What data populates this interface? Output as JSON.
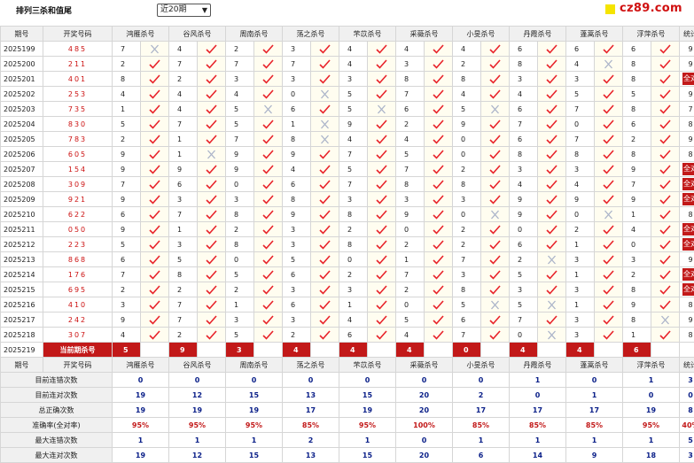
{
  "header": {
    "title": "排列三杀和值尾",
    "period_select": "近20期",
    "period_arrow": "▼",
    "logo": "cz89.com"
  },
  "columns": {
    "issue": "期号",
    "draw": "开奖号码",
    "experts": [
      "鸿雁杀号",
      "谷风杀号",
      "周南杀号",
      "荡之杀号",
      "芣苡杀号",
      "采薇杀号",
      "小旻杀号",
      "丹霞杀号",
      "蓬蒿杀号",
      "浮萍杀号"
    ],
    "stat": "统计"
  },
  "rows": [
    {
      "issue": "2025199",
      "draw": "485",
      "picks": [
        [
          7,
          0
        ],
        [
          4,
          1
        ],
        [
          2,
          1
        ],
        [
          3,
          1
        ],
        [
          4,
          1
        ],
        [
          4,
          1
        ],
        [
          4,
          1
        ],
        [
          6,
          1
        ],
        [
          6,
          1
        ],
        [
          6,
          1
        ]
      ],
      "stat": "9"
    },
    {
      "issue": "2025200",
      "draw": "211",
      "picks": [
        [
          2,
          1
        ],
        [
          7,
          1
        ],
        [
          7,
          1
        ],
        [
          7,
          1
        ],
        [
          4,
          1
        ],
        [
          3,
          1
        ],
        [
          2,
          1
        ],
        [
          8,
          1
        ],
        [
          4,
          0
        ],
        [
          8,
          1
        ]
      ],
      "stat": "9"
    },
    {
      "issue": "2025201",
      "draw": "401",
      "picks": [
        [
          8,
          1
        ],
        [
          2,
          1
        ],
        [
          3,
          1
        ],
        [
          3,
          1
        ],
        [
          3,
          1
        ],
        [
          8,
          1
        ],
        [
          8,
          1
        ],
        [
          3,
          1
        ],
        [
          3,
          1
        ],
        [
          8,
          1
        ]
      ],
      "stat": "全对"
    },
    {
      "issue": "2025202",
      "draw": "253",
      "picks": [
        [
          4,
          1
        ],
        [
          4,
          1
        ],
        [
          4,
          1
        ],
        [
          0,
          0
        ],
        [
          5,
          1
        ],
        [
          7,
          1
        ],
        [
          4,
          1
        ],
        [
          4,
          1
        ],
        [
          5,
          1
        ],
        [
          5,
          1
        ]
      ],
      "stat": "9"
    },
    {
      "issue": "2025203",
      "draw": "735",
      "picks": [
        [
          1,
          1
        ],
        [
          4,
          1
        ],
        [
          5,
          0
        ],
        [
          6,
          1
        ],
        [
          5,
          0
        ],
        [
          6,
          1
        ],
        [
          5,
          0
        ],
        [
          6,
          1
        ],
        [
          7,
          1
        ],
        [
          8,
          1
        ]
      ],
      "stat": "7"
    },
    {
      "issue": "2025204",
      "draw": "830",
      "picks": [
        [
          5,
          1
        ],
        [
          7,
          1
        ],
        [
          5,
          1
        ],
        [
          1,
          0
        ],
        [
          9,
          1
        ],
        [
          2,
          1
        ],
        [
          9,
          1
        ],
        [
          7,
          1
        ],
        [
          0,
          1
        ],
        [
          6,
          1
        ]
      ],
      "stat": "8"
    },
    {
      "issue": "2025205",
      "draw": "783",
      "picks": [
        [
          2,
          1
        ],
        [
          1,
          1
        ],
        [
          7,
          1
        ],
        [
          8,
          0
        ],
        [
          4,
          1
        ],
        [
          4,
          1
        ],
        [
          0,
          1
        ],
        [
          6,
          1
        ],
        [
          7,
          1
        ],
        [
          2,
          1
        ]
      ],
      "stat": "9"
    },
    {
      "issue": "2025206",
      "draw": "605",
      "picks": [
        [
          9,
          1
        ],
        [
          1,
          0
        ],
        [
          9,
          1
        ],
        [
          9,
          1
        ],
        [
          7,
          1
        ],
        [
          5,
          1
        ],
        [
          0,
          1
        ],
        [
          8,
          1
        ],
        [
          8,
          1
        ],
        [
          8,
          1
        ]
      ],
      "stat": "8"
    },
    {
      "issue": "2025207",
      "draw": "154",
      "picks": [
        [
          9,
          1
        ],
        [
          9,
          1
        ],
        [
          9,
          1
        ],
        [
          4,
          1
        ],
        [
          5,
          1
        ],
        [
          7,
          1
        ],
        [
          2,
          1
        ],
        [
          3,
          1
        ],
        [
          3,
          1
        ],
        [
          9,
          1
        ]
      ],
      "stat": "全对"
    },
    {
      "issue": "2025208",
      "draw": "309",
      "picks": [
        [
          7,
          1
        ],
        [
          6,
          1
        ],
        [
          0,
          1
        ],
        [
          6,
          1
        ],
        [
          7,
          1
        ],
        [
          8,
          1
        ],
        [
          8,
          1
        ],
        [
          4,
          1
        ],
        [
          4,
          1
        ],
        [
          7,
          1
        ]
      ],
      "stat": "全对"
    },
    {
      "issue": "2025209",
      "draw": "921",
      "picks": [
        [
          9,
          1
        ],
        [
          3,
          1
        ],
        [
          3,
          1
        ],
        [
          8,
          1
        ],
        [
          3,
          1
        ],
        [
          3,
          1
        ],
        [
          3,
          1
        ],
        [
          9,
          1
        ],
        [
          9,
          1
        ],
        [
          9,
          1
        ]
      ],
      "stat": "全对"
    },
    {
      "issue": "2025210",
      "draw": "622",
      "picks": [
        [
          6,
          1
        ],
        [
          7,
          1
        ],
        [
          8,
          1
        ],
        [
          9,
          1
        ],
        [
          8,
          1
        ],
        [
          9,
          1
        ],
        [
          0,
          0
        ],
        [
          9,
          1
        ],
        [
          0,
          0
        ],
        [
          1,
          1
        ]
      ],
      "stat": "8"
    },
    {
      "issue": "2025211",
      "draw": "050",
      "picks": [
        [
          9,
          1
        ],
        [
          1,
          1
        ],
        [
          2,
          1
        ],
        [
          3,
          1
        ],
        [
          2,
          1
        ],
        [
          0,
          1
        ],
        [
          2,
          1
        ],
        [
          0,
          1
        ],
        [
          2,
          1
        ],
        [
          4,
          1
        ]
      ],
      "stat": "全对"
    },
    {
      "issue": "2025212",
      "draw": "223",
      "picks": [
        [
          5,
          1
        ],
        [
          3,
          1
        ],
        [
          8,
          1
        ],
        [
          3,
          1
        ],
        [
          8,
          1
        ],
        [
          2,
          1
        ],
        [
          2,
          1
        ],
        [
          6,
          1
        ],
        [
          1,
          1
        ],
        [
          0,
          1
        ]
      ],
      "stat": "全对"
    },
    {
      "issue": "2025213",
      "draw": "868",
      "picks": [
        [
          6,
          1
        ],
        [
          5,
          1
        ],
        [
          0,
          1
        ],
        [
          5,
          1
        ],
        [
          0,
          1
        ],
        [
          1,
          1
        ],
        [
          7,
          1
        ],
        [
          2,
          0
        ],
        [
          3,
          1
        ],
        [
          3,
          1
        ]
      ],
      "stat": "9"
    },
    {
      "issue": "2025214",
      "draw": "176",
      "picks": [
        [
          7,
          1
        ],
        [
          8,
          1
        ],
        [
          5,
          1
        ],
        [
          6,
          1
        ],
        [
          2,
          1
        ],
        [
          7,
          1
        ],
        [
          3,
          1
        ],
        [
          5,
          1
        ],
        [
          1,
          1
        ],
        [
          2,
          1
        ]
      ],
      "stat": "全对"
    },
    {
      "issue": "2025215",
      "draw": "695",
      "picks": [
        [
          2,
          1
        ],
        [
          2,
          1
        ],
        [
          2,
          1
        ],
        [
          3,
          1
        ],
        [
          3,
          1
        ],
        [
          2,
          1
        ],
        [
          8,
          1
        ],
        [
          3,
          1
        ],
        [
          3,
          1
        ],
        [
          8,
          1
        ]
      ],
      "stat": "全对"
    },
    {
      "issue": "2025216",
      "draw": "410",
      "picks": [
        [
          3,
          1
        ],
        [
          7,
          1
        ],
        [
          1,
          1
        ],
        [
          6,
          1
        ],
        [
          1,
          1
        ],
        [
          0,
          1
        ],
        [
          5,
          0
        ],
        [
          5,
          0
        ],
        [
          1,
          1
        ],
        [
          9,
          1
        ]
      ],
      "stat": "8"
    },
    {
      "issue": "2025217",
      "draw": "242",
      "picks": [
        [
          9,
          1
        ],
        [
          7,
          1
        ],
        [
          3,
          1
        ],
        [
          3,
          1
        ],
        [
          4,
          1
        ],
        [
          5,
          1
        ],
        [
          6,
          1
        ],
        [
          7,
          1
        ],
        [
          3,
          1
        ],
        [
          8,
          0
        ]
      ],
      "stat": "9"
    },
    {
      "issue": "2025218",
      "draw": "307",
      "picks": [
        [
          4,
          1
        ],
        [
          2,
          1
        ],
        [
          5,
          1
        ],
        [
          2,
          1
        ],
        [
          6,
          1
        ],
        [
          4,
          1
        ],
        [
          7,
          1
        ],
        [
          0,
          0
        ],
        [
          3,
          1
        ],
        [
          1,
          1
        ]
      ],
      "stat": "8"
    }
  ],
  "current": {
    "issue": "2025219",
    "label": "当前期杀号",
    "picks": [
      5,
      9,
      3,
      4,
      4,
      4,
      0,
      4,
      4,
      6
    ]
  },
  "summary": [
    {
      "label": "目前连错次数",
      "values": [
        "0",
        "0",
        "0",
        "0",
        "0",
        "0",
        "0",
        "1",
        "0",
        "1"
      ],
      "stat": "3"
    },
    {
      "label": "目前连对次数",
      "values": [
        "19",
        "12",
        "15",
        "13",
        "15",
        "20",
        "2",
        "0",
        "1",
        "0"
      ],
      "stat": "0"
    },
    {
      "label": "总正确次数",
      "values": [
        "19",
        "19",
        "19",
        "17",
        "19",
        "20",
        "17",
        "17",
        "17",
        "19"
      ],
      "stat": "8"
    },
    {
      "label": "准确率(全对率)",
      "values": [
        "95%",
        "95%",
        "95%",
        "85%",
        "95%",
        "100%",
        "85%",
        "85%",
        "85%",
        "95%"
      ],
      "stat": "40%",
      "red": true
    },
    {
      "label": "最大连错次数",
      "values": [
        "1",
        "1",
        "1",
        "2",
        "1",
        "0",
        "1",
        "1",
        "1",
        "1"
      ],
      "stat": "5"
    },
    {
      "label": "最大连对次数",
      "values": [
        "19",
        "12",
        "15",
        "13",
        "15",
        "20",
        "6",
        "14",
        "9",
        "18"
      ],
      "stat": "3"
    }
  ],
  "colors": {
    "correct": "#e8232a",
    "wrong": "#aab3c9",
    "all_correct_bg": "#c21919",
    "summary_text": "#0a1f88"
  }
}
